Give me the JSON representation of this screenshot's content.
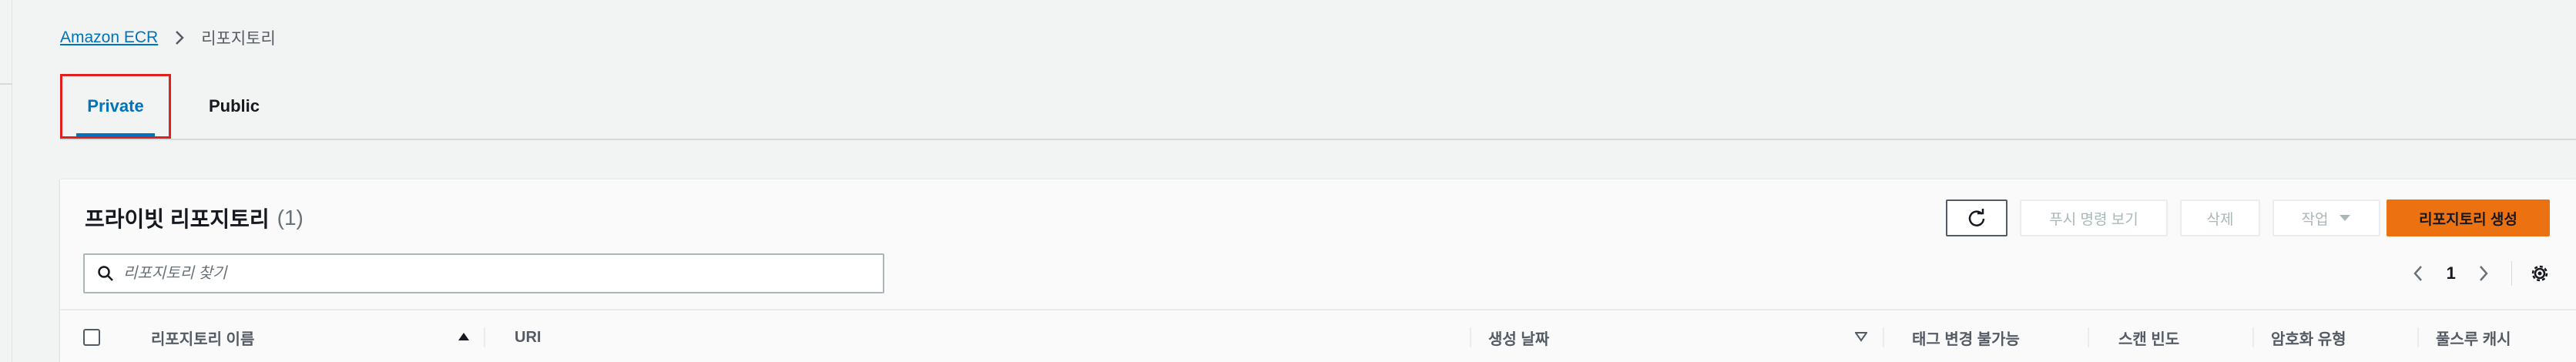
{
  "breadcrumb": {
    "root": "Amazon ECR",
    "current": "리포지토리"
  },
  "tabs": {
    "private": "Private",
    "public": "Public"
  },
  "panel": {
    "title": "프라이빗 리포지토리",
    "count": "(1)"
  },
  "toolbar": {
    "push_commands": "푸시 명령 보기",
    "delete": "삭제",
    "actions": "작업",
    "create": "리포지토리 생성"
  },
  "search": {
    "placeholder": "리포지토리 찾기",
    "value": ""
  },
  "pagination": {
    "page": "1"
  },
  "table": {
    "columns": [
      "리포지토리 이름",
      "URI",
      "생성 날짜",
      "태그 변경 불가능",
      "스캔 빈도",
      "암호화 유형",
      "풀스루 캐시"
    ]
  },
  "colors": {
    "accent": "#0073bb",
    "primary_button": "#ec7211",
    "highlight_box": "#e02020"
  }
}
